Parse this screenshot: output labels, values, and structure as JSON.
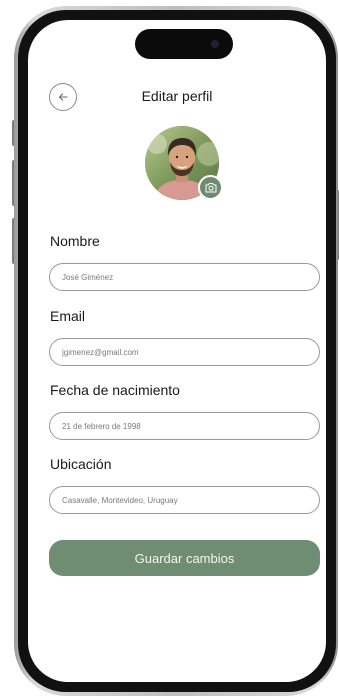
{
  "header": {
    "title": "Editar perfil",
    "back_icon": "arrow-left-icon"
  },
  "profile": {
    "avatar": "avatar",
    "camera_icon": "camera-icon"
  },
  "form": {
    "fields": [
      {
        "label": "Nombre",
        "value": "José Giménez"
      },
      {
        "label": "Email",
        "value": "jgimenez@gmail.com"
      },
      {
        "label": "Fecha de nacimiento",
        "value": "21 de febrero de 1998"
      },
      {
        "label": "Ubicación",
        "value": "Casavalle, Montevideo, Uruguay"
      }
    ],
    "save_label": "Guardar cambios"
  },
  "colors": {
    "accent": "#6f8d72",
    "input_border": "#9a9a9a",
    "text": "#1a1a1a"
  }
}
